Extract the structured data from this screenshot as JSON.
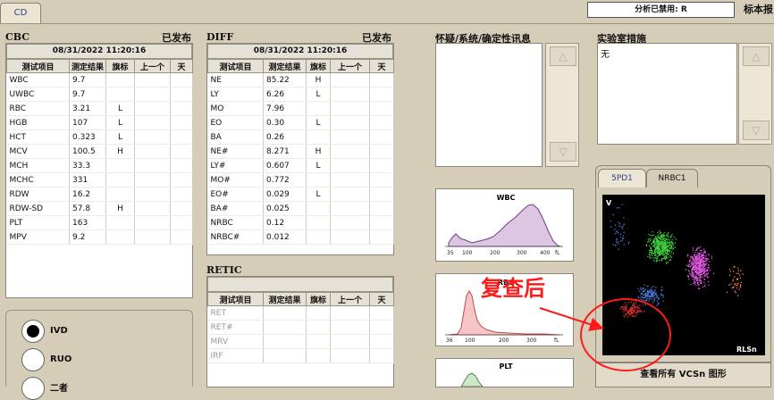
{
  "top": {
    "tab_label": "CD",
    "status_text": "分析已禁用: R",
    "right_label": "标本报"
  },
  "cbc": {
    "title": "CBC",
    "status": "已发布",
    "datetime": "08/31/2022 11:20:16",
    "headers": [
      "测试项目",
      "测定结果",
      "旗标",
      "上一个",
      "天"
    ],
    "rows": [
      {
        "name": "WBC",
        "value": "9.7",
        "flag": ""
      },
      {
        "name": "UWBC",
        "value": "9.7",
        "flag": ""
      },
      {
        "name": "RBC",
        "value": "3.21",
        "flag": "L"
      },
      {
        "name": "HGB",
        "value": "107",
        "flag": "L"
      },
      {
        "name": "HCT",
        "value": "0.323",
        "flag": "L"
      },
      {
        "name": "MCV",
        "value": "100.5",
        "flag": "H"
      },
      {
        "name": "MCH",
        "value": "33.3",
        "flag": ""
      },
      {
        "name": "MCHC",
        "value": "331",
        "flag": ""
      },
      {
        "name": "RDW",
        "value": "16.2",
        "flag": ""
      },
      {
        "name": "RDW-SD",
        "value": "57.8",
        "flag": "H"
      },
      {
        "name": "PLT",
        "value": "163",
        "flag": ""
      },
      {
        "name": "MPV",
        "value": "9.2",
        "flag": ""
      }
    ]
  },
  "diff": {
    "title": "DIFF",
    "status": "已发布",
    "datetime": "08/31/2022 11:20:16",
    "headers": [
      "测试项目",
      "测定结果",
      "旗标",
      "上一个",
      "天"
    ],
    "rows": [
      {
        "name": "NE",
        "value": "85.22",
        "flag": "H"
      },
      {
        "name": "LY",
        "value": "6.26",
        "flag": "L"
      },
      {
        "name": "MO",
        "value": "7.96",
        "flag": ""
      },
      {
        "name": "EO",
        "value": "0.30",
        "flag": "L"
      },
      {
        "name": "BA",
        "value": "0.26",
        "flag": ""
      },
      {
        "name": "NE#",
        "value": "8.271",
        "flag": "H"
      },
      {
        "name": "LY#",
        "value": "0.607",
        "flag": "L"
      },
      {
        "name": "MO#",
        "value": "0.772",
        "flag": ""
      },
      {
        "name": "EO#",
        "value": "0.029",
        "flag": "L"
      },
      {
        "name": "BA#",
        "value": "0.025",
        "flag": ""
      },
      {
        "name": "NRBC",
        "value": "0.12",
        "flag": ""
      },
      {
        "name": "NRBC#",
        "value": "0.012",
        "flag": ""
      }
    ]
  },
  "retic": {
    "title": "RETIC",
    "headers": [
      "测试项目",
      "测定结果",
      "旗标",
      "上一个",
      "天"
    ],
    "rows": [
      {
        "name": "RET"
      },
      {
        "name": "RET#"
      },
      {
        "name": "MRV"
      },
      {
        "name": "IRF"
      }
    ]
  },
  "suspect": {
    "title": "怀疑/系统/确定性讯息",
    "up_glyph": "△",
    "down_glyph": "▽"
  },
  "lab": {
    "title": "实验室措施",
    "text": "无",
    "up_glyph": "△",
    "down_glyph": "▽"
  },
  "histograms": {
    "wbc": {
      "title": "WBC",
      "ticks": [
        "35",
        "100",
        "200",
        "300",
        "400",
        "fL"
      ]
    },
    "rbc": {
      "title": "RBC",
      "ticks": [
        "36",
        "100",
        "200",
        "300",
        "fL"
      ]
    },
    "plt": {
      "title": "PLT"
    }
  },
  "scatter": {
    "tabs": [
      "5PD1",
      "NRBC1"
    ],
    "corner_label": "V",
    "axis_label": "RLSn",
    "view_all_button": "查看所有 VCSn 图形"
  },
  "annotation": {
    "text": "复查后",
    "color": "#ff1a1a"
  },
  "mode": {
    "options": [
      "IVD",
      "RUO",
      "二者"
    ]
  },
  "colors": {
    "background": "#d6cdb8",
    "accent_tab": "#2e3e8e",
    "wbc_fill": "#dcc6e4",
    "rbc_fill": "#f6c6c6"
  }
}
